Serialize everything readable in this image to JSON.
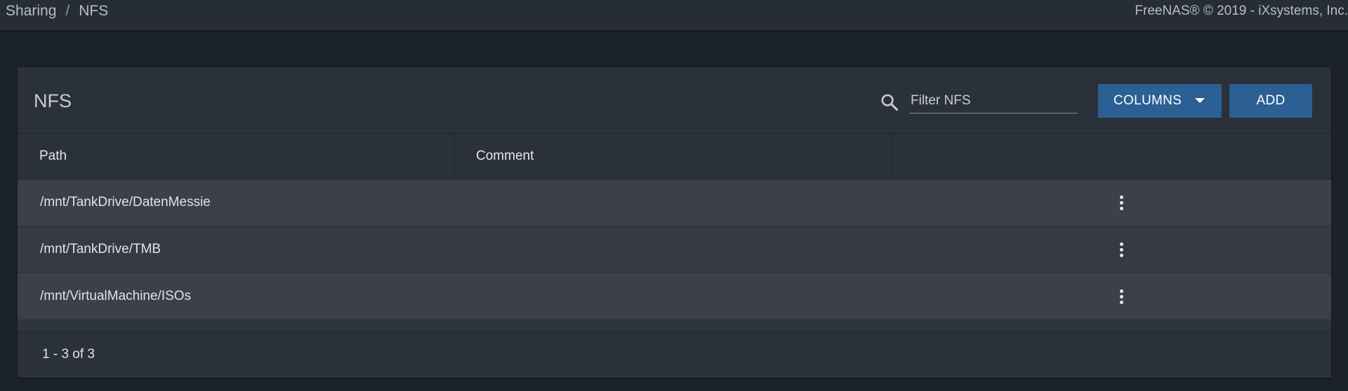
{
  "breadcrumb": {
    "items": [
      "Sharing",
      "NFS"
    ],
    "separator": "/"
  },
  "copyright": "FreeNAS® © 2019 - iXsystems, Inc.",
  "card": {
    "title": "NFS",
    "search": {
      "icon": "search-icon",
      "placeholder": "Filter NFS",
      "value": ""
    },
    "columns_button": "COLUMNS",
    "add_button": "ADD"
  },
  "table": {
    "columns": [
      "Path",
      "Comment",
      ""
    ],
    "rows": [
      {
        "path": "/mnt/TankDrive/DatenMessie",
        "comment": ""
      },
      {
        "path": "/mnt/TankDrive/TMB",
        "comment": ""
      },
      {
        "path": "/mnt/VirtualMachine/ISOs",
        "comment": ""
      }
    ],
    "row_action_icon": "more-vert-icon"
  },
  "paginator": "1 - 3 of 3",
  "colors": {
    "background": "#1c222b",
    "topbar": "#262d36",
    "card": "#2a313a",
    "primary_button": "#2c5f93",
    "row_odd": "#3b4049",
    "row_even": "#363b43"
  }
}
